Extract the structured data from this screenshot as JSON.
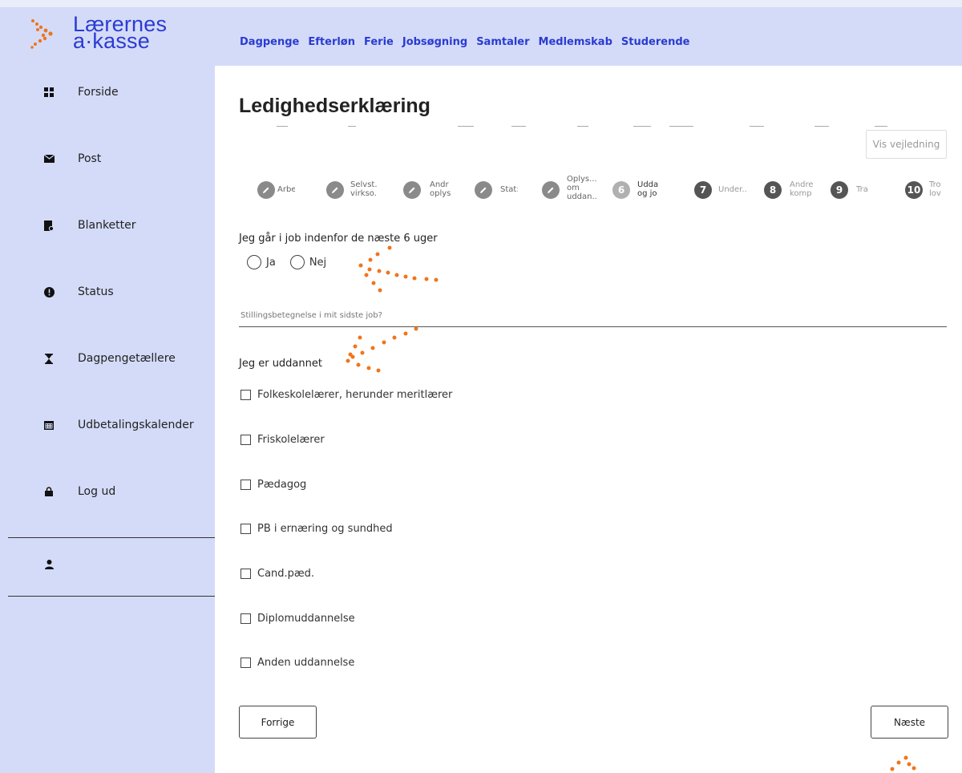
{
  "brand": {
    "line1": "Lærernes",
    "line2": "a·kasse",
    "accent": "#2b3bd1",
    "dot_color": "#f0751b"
  },
  "topnav": [
    "Dagpenge",
    "Efterløn",
    "Ferie",
    "Jobsøgning",
    "Samtaler",
    "Medlemskab",
    "Studerende"
  ],
  "sidebar": {
    "items": [
      {
        "label": "Forside",
        "icon": "grid-icon"
      },
      {
        "label": "Post",
        "icon": "envelope-icon"
      },
      {
        "label": "Blanketter",
        "icon": "form-document-icon"
      },
      {
        "label": "Status",
        "icon": "exclamation-circle-icon"
      },
      {
        "label": "Dagpengetællere",
        "icon": "hourglass-icon"
      },
      {
        "label": "Udbetalingskalender",
        "icon": "calendar-icon"
      },
      {
        "label": "Log ud",
        "icon": "lock-icon"
      }
    ],
    "user_icon": "user-icon"
  },
  "page": {
    "title": "Ledighedserklæring",
    "guide_button": "Vis vejledning"
  },
  "stepper": [
    {
      "marker": "",
      "label": "Arbe"
    },
    {
      "marker": "",
      "label": "Selvst.\nvirkso."
    },
    {
      "marker": "",
      "label": "Andr\noplys"
    },
    {
      "marker": "",
      "label": "Stat:"
    },
    {
      "marker": "",
      "label": "Oplys...\nom\nuddan.."
    },
    {
      "marker": "6",
      "label": "Udda\nog jo"
    },
    {
      "marker": "7",
      "label": "Under.."
    },
    {
      "marker": "8",
      "label": "Andre\nkomp"
    },
    {
      "marker": "9",
      "label": "Tra"
    },
    {
      "marker": "10",
      "label": "Tro\nlov"
    }
  ],
  "form": {
    "job_question": "Jeg går i job indenfor de næste 6 uger",
    "radio_options": [
      "Ja",
      "Nej"
    ],
    "job_title_placeholder": "Stillingsbetegnelse i mit sidste job?",
    "education_label": "Jeg er uddannet",
    "education_options": [
      "Folkeskolelærer, herunder meritlærer",
      "Friskolelærer",
      "Pædagog",
      "PB i ernæring og sundhed",
      "Cand.pæd.",
      "Diplomuddannelse",
      "Anden uddannelse"
    ]
  },
  "buttons": {
    "previous": "Forrige",
    "next": "Næste"
  }
}
